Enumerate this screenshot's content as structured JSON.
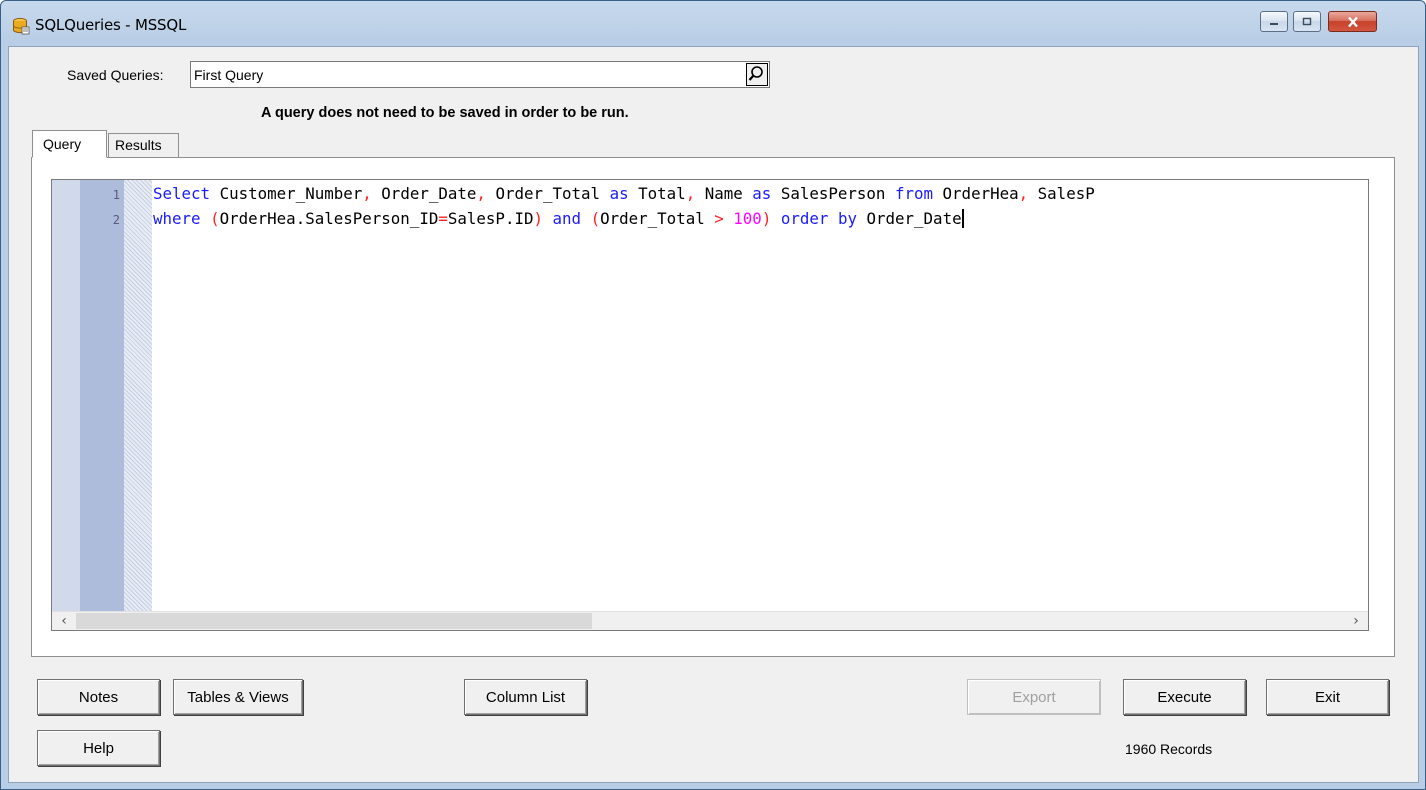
{
  "window": {
    "title": "SQLQueries - MSSQL",
    "icon": "database-icon",
    "controls": [
      "minimize-icon",
      "maximize-icon",
      "close-icon"
    ]
  },
  "saved_queries": {
    "label": "Saved Queries:",
    "value": "First Query",
    "search_icon": "magnifier-icon"
  },
  "info_text": "A query does not need to be saved in order to be run.",
  "tabs": [
    {
      "label": "Query",
      "active": true
    },
    {
      "label": "Results",
      "active": false
    }
  ],
  "editor": {
    "line_numbers": [
      "1",
      "2"
    ],
    "lines": [
      "Select Customer_Number, Order_Date, Order_Total as Total, Name as SalesPerson from OrderHea, SalesP",
      "where (OrderHea.SalesPerson_ID=SalesP.ID) and (Order_Total > 100) order by Order_Date"
    ],
    "colors": {
      "keyword": "#1a1aff",
      "operator": "#ff2020",
      "number": "#ff00ff"
    }
  },
  "buttons": {
    "notes": "Notes",
    "tables_views": "Tables & Views",
    "column_list": "Column List",
    "export": "Export",
    "execute": "Execute",
    "exit": "Exit",
    "help": "Help"
  },
  "status": {
    "records": "1960 Records"
  }
}
